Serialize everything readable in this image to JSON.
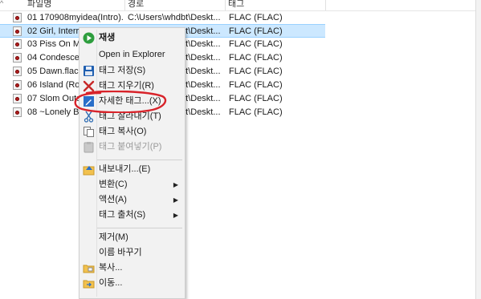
{
  "list": {
    "columns": {
      "name": "파일명",
      "path": "경로",
      "tag": "태그"
    },
    "sort_indicator": "^",
    "rows": [
      {
        "name": "01 170908myidea(Intro)...",
        "path": "C:\\Users\\whdbt\\Deskt...",
        "tag": "FLAC (FLAC)",
        "selected": false
      },
      {
        "name": "02 Girl, Interrupted.flac",
        "path": "C:\\Users\\whdbt\\Deskt...",
        "tag": "FLAC (FLAC)",
        "selected": true
      },
      {
        "name": "03 Piss On Me",
        "path": "C:\\Users\\whdbt\\Deskt...",
        "tag": "FLAC (FLAC)",
        "selected": false
      },
      {
        "name": "04 Condescen",
        "path": "C:\\Users\\whdbt\\Deskt...",
        "tag": "FLAC (FLAC)",
        "selected": false
      },
      {
        "name": "05 Dawn.flac",
        "path": "C:\\Users\\whdbt\\Deskt...",
        "tag": "FLAC (FLAC)",
        "selected": false
      },
      {
        "name": "06 Island (Rou",
        "path": "C:\\Users\\whdbt\\Deskt...",
        "tag": "FLAC (FLAC)",
        "selected": false
      },
      {
        "name": "07 Slom Outs",
        "path": "C:\\Users\\whdbt\\Deskt...",
        "tag": "FLAC (FLAC)",
        "selected": false
      },
      {
        "name": "08 ~Lonely Bi",
        "path": "C:\\Users\\whdbt\\Deskt...",
        "tag": "FLAC (FLAC)",
        "selected": false
      }
    ]
  },
  "context_menu": {
    "items": [
      {
        "label": "재생",
        "icon": "play-icon",
        "bold": true
      },
      {
        "label": "Open in Explorer",
        "icon": ""
      },
      {
        "label": "태그 저장(S)",
        "icon": "save-disk-icon"
      },
      {
        "label": "태그 지우기(R)",
        "icon": "remove-x-icon"
      },
      {
        "label": "자세한 태그...(X)",
        "icon": "pencil-edit-icon"
      },
      {
        "label": "태그 잘라내기(T)",
        "icon": "scissors-icon"
      },
      {
        "label": "태그 복사(O)",
        "icon": "copy-icon"
      },
      {
        "label": "태그 붙여넣기(P)",
        "icon": "paste-icon",
        "disabled": true
      },
      {
        "label": "내보내기...(E)",
        "icon": "export-icon"
      },
      {
        "label": "변환(C)",
        "submenu": true
      },
      {
        "label": "액션(A)",
        "submenu": true
      },
      {
        "label": "태그 출처(S)",
        "submenu": true
      },
      {
        "label": "제거(M)"
      },
      {
        "label": "이름 바꾸기"
      },
      {
        "label": "복사...",
        "icon": "folder-copy-icon"
      },
      {
        "label": "이동...",
        "icon": "folder-move-icon"
      }
    ],
    "submenu_arrow": "▶"
  },
  "annotation": {
    "color": "#d8232a",
    "target": "자세한 태그...(X)"
  },
  "colors": {
    "selection_bg": "#cce8ff",
    "menu_bg": "#f2f2f2",
    "play_green": "#2e9e3e",
    "disk_blue": "#1f5fb0"
  }
}
